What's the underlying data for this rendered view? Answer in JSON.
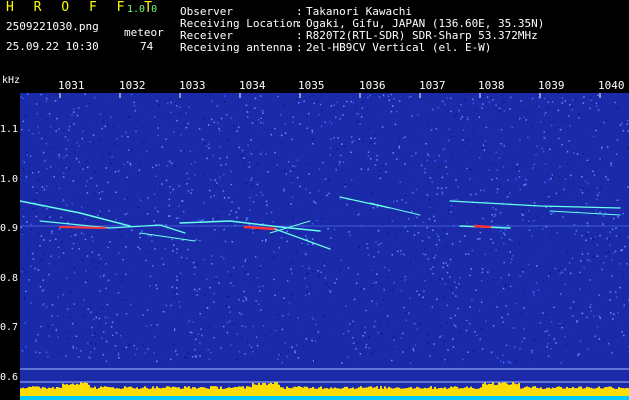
{
  "header": {
    "app_name": "H R O F F T",
    "version": "1.0.0",
    "filename": "2509221030.png",
    "meteor_label": "meteor",
    "datetime": "25.09.22 10:30",
    "meteor_count": "74"
  },
  "info": [
    {
      "label": "Observer",
      "value": "Takanori Kawachi"
    },
    {
      "label": "Receiving Location",
      "value": "Ogaki, Gifu, JAPAN (136.60E, 35.35N)"
    },
    {
      "label": "Receiver",
      "value": "R820T2(RTL-SDR) SDR-Sharp 53.372MHz"
    },
    {
      "label": "Receiving antenna",
      "value": "2el-HB9CV Vertical (el. E-W)"
    }
  ],
  "axis": {
    "y_unit": "kHz",
    "y_ticks": [
      "1.1",
      "1.0",
      "0.9",
      "0.8",
      "0.7",
      "0.6"
    ],
    "x_ticks": [
      "1031",
      "1032",
      "1033",
      "1034",
      "1035",
      "1036",
      "1037",
      "1038",
      "1039",
      "1040"
    ]
  },
  "colors": {
    "background_noise": "#1a2aa8",
    "signal_core": "#ff3333",
    "signal_trail": "#66ffee",
    "level_bar": "#ffdd00",
    "level_base": "#00ccff"
  }
}
